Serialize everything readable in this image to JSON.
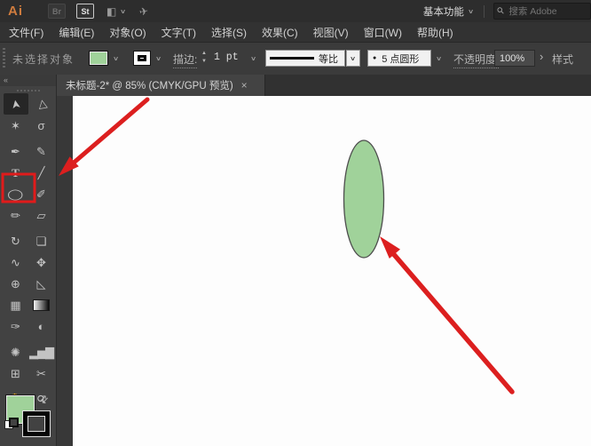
{
  "app": {
    "logo": "Ai",
    "bridge_badge": "Br",
    "stock_badge": "St",
    "workspace": "基本功能",
    "search_placeholder": "搜索 Adobe"
  },
  "icons": {
    "layout": "◧",
    "share": "✈",
    "search": "⚲",
    "chevron_down": "∨",
    "collapse": "«",
    "step_up": "▲",
    "step_down": "▼",
    "bullet": "●",
    "more_arrow": "›",
    "swap": "⇄"
  },
  "menu": {
    "items": [
      "文件(F)",
      "编辑(E)",
      "对象(O)",
      "文字(T)",
      "选择(S)",
      "效果(C)",
      "视图(V)",
      "窗口(W)",
      "帮助(H)"
    ]
  },
  "control_bar": {
    "status": "未选择对象",
    "stroke_label": "描边:",
    "stroke_weight": "1 pt",
    "profile_label": "等比",
    "brush_label": "5 点圆形",
    "opacity_label": "不透明度:",
    "opacity_value": "100%",
    "style_label": "样式",
    "fill_color": "#a0d29a",
    "stroke_color": "#000000"
  },
  "document_tab": {
    "title": "未标题-2* @ 85% (CMYK/GPU 预览)",
    "close": "×"
  },
  "toolbar": {
    "fill_color": "#a0d29a",
    "tools": [
      {
        "name": "selection",
        "glyph": "➤"
      },
      {
        "name": "direct-selection",
        "glyph": "▷"
      },
      {
        "name": "magic-wand",
        "glyph": "✶"
      },
      {
        "name": "lasso",
        "glyph": "σ"
      },
      {
        "name": "pen",
        "glyph": "✒"
      },
      {
        "name": "curvature",
        "glyph": "✎"
      },
      {
        "name": "type",
        "glyph": "T"
      },
      {
        "name": "line-segment",
        "glyph": "╱"
      },
      {
        "name": "ellipse",
        "glyph": "◯"
      },
      {
        "name": "paintbrush",
        "glyph": "✐"
      },
      {
        "name": "pencil",
        "glyph": "✏"
      },
      {
        "name": "eraser",
        "glyph": "▱"
      },
      {
        "name": "rotate",
        "glyph": "↻"
      },
      {
        "name": "scale",
        "glyph": "❏"
      },
      {
        "name": "width",
        "glyph": "∿"
      },
      {
        "name": "free-transform",
        "glyph": "✥"
      },
      {
        "name": "shape-builder",
        "glyph": "⊕"
      },
      {
        "name": "perspective-grid",
        "glyph": "◺"
      },
      {
        "name": "mesh",
        "glyph": "▦"
      },
      {
        "name": "gradient",
        "glyph": ""
      },
      {
        "name": "eyedropper",
        "glyph": "✑"
      },
      {
        "name": "blend",
        "glyph": "◐"
      },
      {
        "name": "symbol-sprayer",
        "glyph": "✺"
      },
      {
        "name": "column-graph",
        "glyph": "▂▅▇"
      },
      {
        "name": "artboard",
        "glyph": "⊞"
      },
      {
        "name": "slice",
        "glyph": "✂"
      },
      {
        "name": "hand",
        "glyph": "✋"
      },
      {
        "name": "zoom",
        "glyph": "⚲"
      }
    ]
  },
  "canvas": {
    "ellipse_fill": "#a0d29a",
    "ellipse_stroke": "#4d4d4d"
  },
  "annotations": {
    "arrow_color": "#dc1f1f",
    "box_color": "#e01b1b"
  }
}
